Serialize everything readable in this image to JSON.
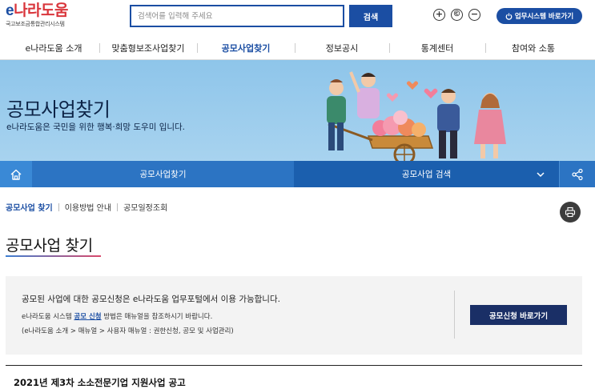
{
  "header": {
    "logo_e": "e",
    "logo_rest": "나라도움",
    "logo_sub": "국고보조금통합관리시스템",
    "search_placeholder": "검색어를 입력해 주세요",
    "search_button": "검색",
    "zoom_in": "+",
    "zoom_reset": "©",
    "zoom_out": "−",
    "biz_button": "업무시스템 바로가기"
  },
  "nav": {
    "items": [
      {
        "label": "e나라도움 소개"
      },
      {
        "label": "맞춤형보조사업찾기"
      },
      {
        "label": "공모사업찾기"
      },
      {
        "label": "정보공시"
      },
      {
        "label": "통계센터"
      },
      {
        "label": "참여와 소통"
      }
    ]
  },
  "banner": {
    "title": "공모사업찾기",
    "desc": "e나라도움은 국민을 위한 행복·희망 도우미 입니다."
  },
  "subnav": {
    "left": "공모사업찾기",
    "right": "공모사업 검색"
  },
  "breadcrumb": {
    "items": [
      "공모사업 찾기",
      "이용방법 안내",
      "공모일정조회"
    ]
  },
  "page_title": "공모사업 찾기",
  "info": {
    "main": "공모된 사업에 대한 공모신청은 e나라도움 업무포털에서 이용 가능합니다.",
    "line2_prefix": "e나라도움 시스템",
    "line2_link": "공모 신청",
    "line2_suffix": "방법은 매뉴얼을 참조하시기 바랍니다.",
    "line3": "(e나라도움 소개 > 매뉴얼 > 사용자 매뉴얼 : 권한신청, 공모 및 사업관리)",
    "apply_button": "공모신청 바로가기"
  },
  "list": {
    "first_item": "2021년 제3차 소소전문기업 지원사업 공고"
  },
  "colors": {
    "brand_blue": "#1b4ea3",
    "brand_red": "#d9353b",
    "subnav_blue": "#2c74c3",
    "banner_sky": "#8ec5ea",
    "apply_navy": "#1a2f66"
  }
}
